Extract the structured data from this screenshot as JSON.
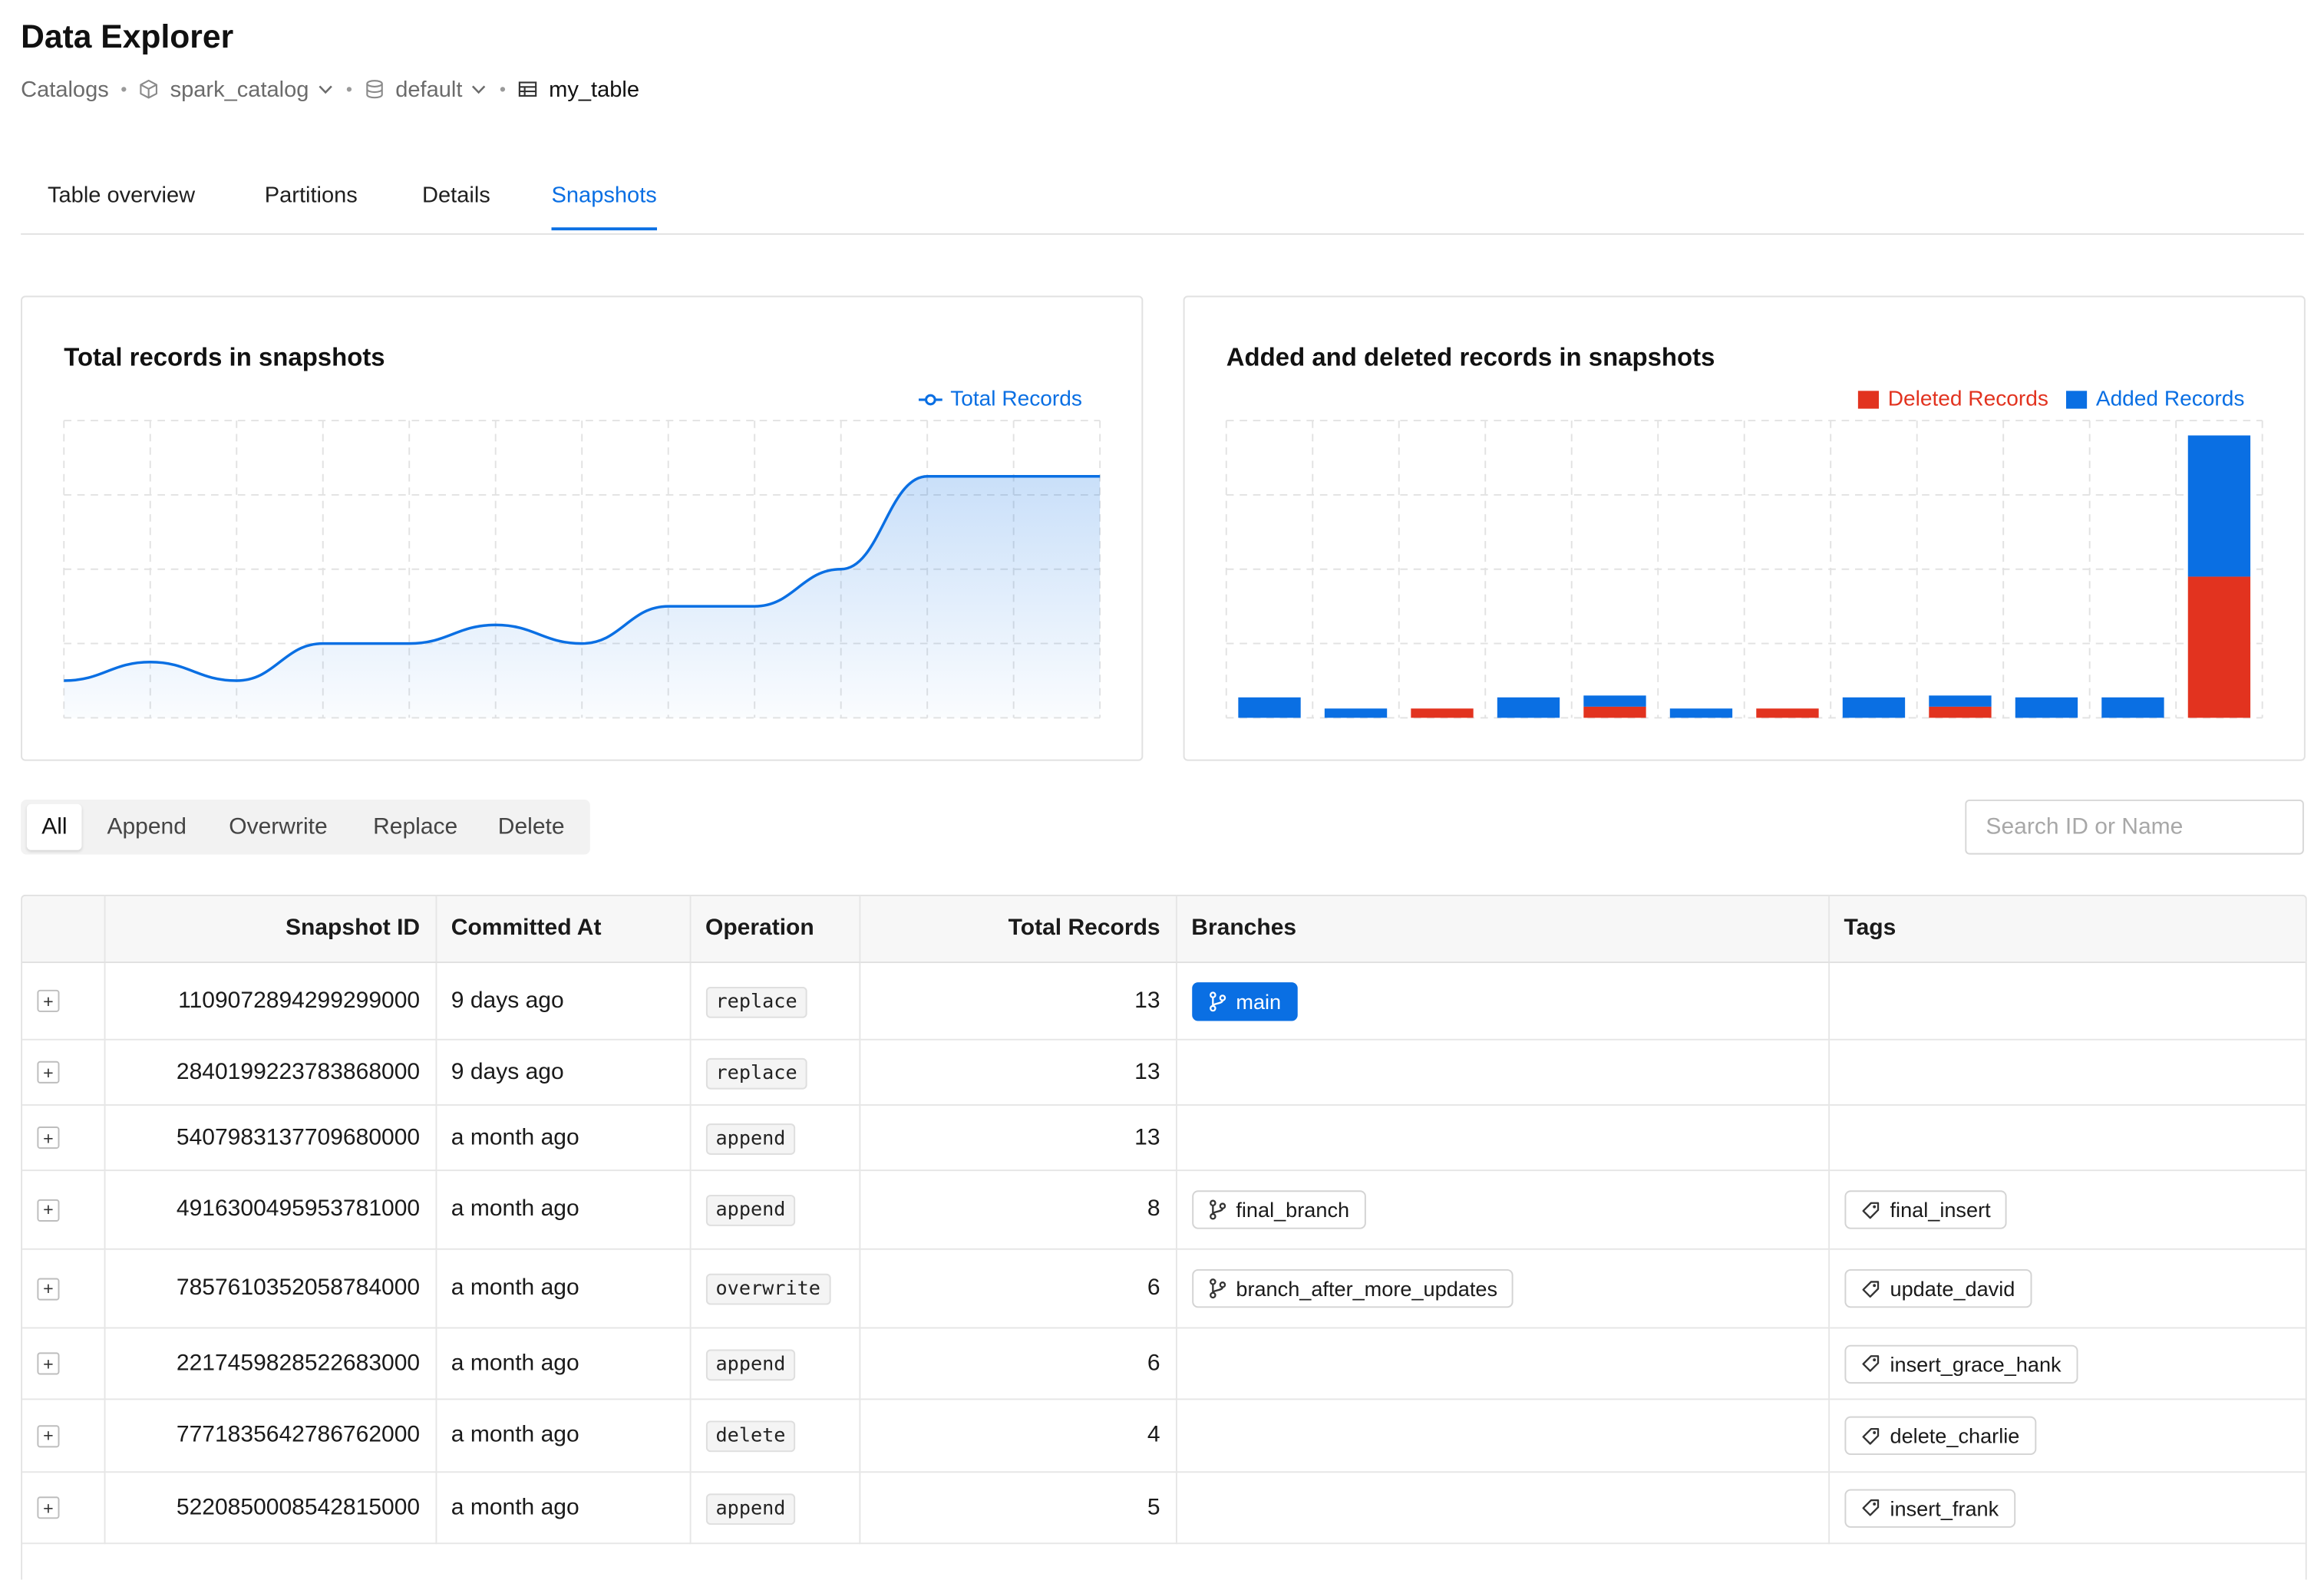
{
  "header": {
    "title": "Data Explorer"
  },
  "breadcrumb": {
    "root": "Catalogs",
    "catalog": "spark_catalog",
    "schema": "default",
    "table": "my_table"
  },
  "tabs": [
    "Table overview",
    "Partitions",
    "Details",
    "Snapshots"
  ],
  "active_tab": "Snapshots",
  "charts": {
    "total": {
      "title": "Total records in snapshots",
      "legend": "Total Records",
      "color": "#0a6fe3"
    },
    "added_deleted": {
      "title": "Added and deleted records in snapshots",
      "legend_deleted": "Deleted Records",
      "legend_added": "Added Records",
      "deleted_color": "#e2331f",
      "added_color": "#0a6fe3"
    }
  },
  "chart_data": [
    {
      "type": "area",
      "title": "Total records in snapshots",
      "series": [
        {
          "name": "Total Records",
          "values": [
            2,
            3,
            2,
            4,
            4,
            5,
            4,
            6,
            6,
            8,
            13,
            13,
            13
          ]
        }
      ],
      "ylim": [
        0,
        16
      ],
      "grid": true,
      "legend": "top-right"
    },
    {
      "type": "bar",
      "title": "Added and deleted records in snapshots",
      "stacked": true,
      "series": [
        {
          "name": "Deleted Records",
          "values": [
            0,
            0,
            0.5,
            0,
            0.6,
            0,
            0.5,
            0,
            0.6,
            0,
            0,
            7.6
          ]
        },
        {
          "name": "Added Records",
          "values": [
            1.1,
            0.5,
            0,
            1.1,
            0.6,
            0.5,
            0,
            1.1,
            0.6,
            1.1,
            1.1,
            7.6
          ]
        }
      ],
      "ylim": [
        0,
        16
      ],
      "grid": true,
      "legend": "top-right"
    }
  ],
  "filters": {
    "options": [
      "All",
      "Append",
      "Overwrite",
      "Replace",
      "Delete"
    ],
    "selected": "All"
  },
  "search": {
    "placeholder": "Search ID or Name",
    "value": ""
  },
  "table": {
    "columns": [
      "",
      "Snapshot ID",
      "Committed At",
      "Operation",
      "Total Records",
      "Branches",
      "Tags"
    ],
    "rows": [
      {
        "id": "1109072894299299000",
        "committed": "9 days ago",
        "op": "replace",
        "total": "13",
        "branch": "main",
        "branch_primary": true,
        "tag": ""
      },
      {
        "id": "2840199223783868000",
        "committed": "9 days ago",
        "op": "replace",
        "total": "13",
        "branch": "",
        "branch_primary": false,
        "tag": ""
      },
      {
        "id": "5407983137709680000",
        "committed": "a month ago",
        "op": "append",
        "total": "13",
        "branch": "",
        "branch_primary": false,
        "tag": ""
      },
      {
        "id": "4916300495953781000",
        "committed": "a month ago",
        "op": "append",
        "total": "8",
        "branch": "final_branch",
        "branch_primary": false,
        "tag": "final_insert"
      },
      {
        "id": "7857610352058784000",
        "committed": "a month ago",
        "op": "overwrite",
        "total": "6",
        "branch": "branch_after_more_updates",
        "branch_primary": false,
        "tag": "update_david"
      },
      {
        "id": "2217459828522683000",
        "committed": "a month ago",
        "op": "append",
        "total": "6",
        "branch": "",
        "branch_primary": false,
        "tag": "insert_grace_hank"
      },
      {
        "id": "7771835642786762000",
        "committed": "a month ago",
        "op": "delete",
        "total": "4",
        "branch": "",
        "branch_primary": false,
        "tag": "delete_charlie"
      },
      {
        "id": "5220850008542815000",
        "committed": "a month ago",
        "op": "append",
        "total": "5",
        "branch": "",
        "branch_primary": false,
        "tag": "insert_frank"
      }
    ]
  }
}
